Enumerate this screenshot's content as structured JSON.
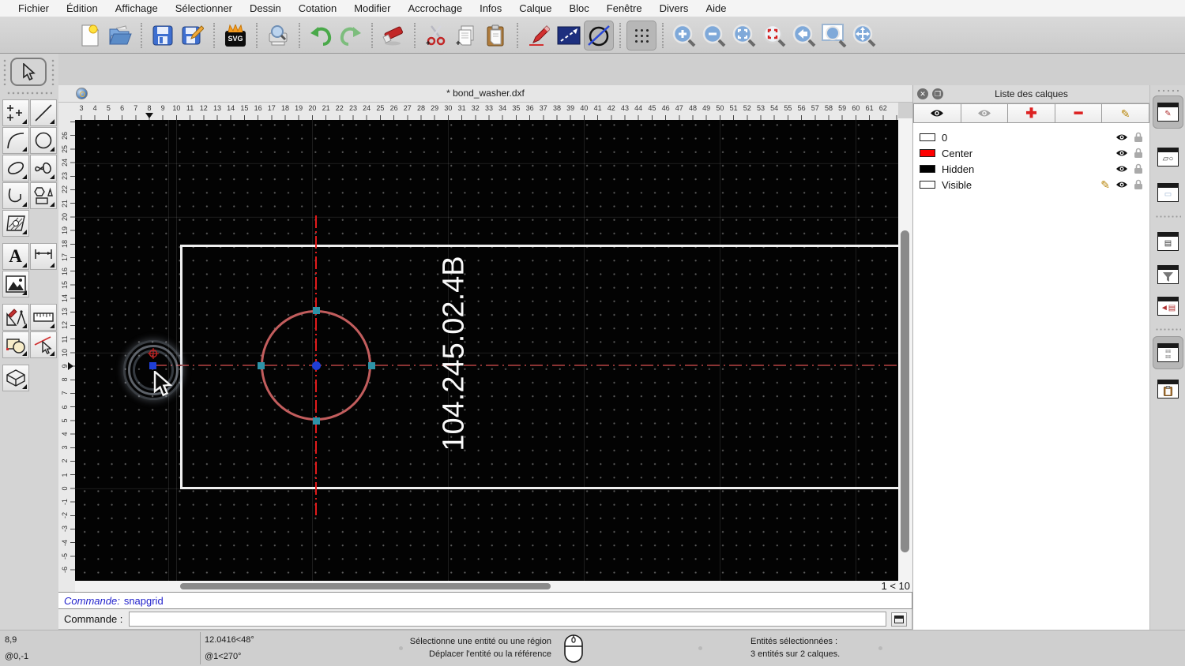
{
  "menubar": {
    "items": [
      "Fichier",
      "Édition",
      "Affichage",
      "Sélectionner",
      "Dessin",
      "Cotation",
      "Modifier",
      "Accrochage",
      "Infos",
      "Calque",
      "Bloc",
      "Fenêtre",
      "Divers",
      "Aide"
    ]
  },
  "toolbar": {
    "svg_label": "SVG"
  },
  "window": {
    "title": "* bond_washer.dxf"
  },
  "palette": {
    "text_tool_glyph": "A"
  },
  "rulers": {
    "top": {
      "values": [
        3,
        4,
        5,
        6,
        7,
        8,
        9,
        10,
        11,
        12,
        13,
        14,
        15,
        16,
        17,
        18,
        19,
        20,
        21,
        22,
        23,
        24,
        25,
        26,
        27,
        28,
        29,
        30,
        31,
        32,
        33,
        34,
        35,
        36,
        37,
        38,
        39,
        40,
        41,
        42,
        43,
        44,
        45,
        46,
        47,
        48,
        49,
        50,
        51,
        52,
        53,
        54,
        55,
        56,
        57,
        58,
        59,
        60,
        61,
        62
      ],
      "marker_value": 8
    },
    "left": {
      "values": [
        26,
        25,
        24,
        23,
        22,
        21,
        20,
        19,
        18,
        17,
        16,
        15,
        14,
        13,
        12,
        11,
        10,
        9,
        8,
        7,
        6,
        5,
        4,
        3,
        2,
        1,
        0,
        -1,
        -2,
        -3,
        -4,
        -5,
        -6
      ],
      "marker_value": 9
    }
  },
  "canvas": {
    "annotation_text": "104.245.02.4B",
    "scale_indicator": "1 < 10",
    "colors": {
      "background": "#030303",
      "entity_white": "#efefef",
      "selected_salmon": "#c25d5d",
      "centerline_red": "#e21b1b",
      "centerline_dark_red": "#8a3333",
      "grip_teal": "#2e93a8",
      "grip_blue": "#1f3ed6"
    }
  },
  "layer_panel": {
    "title": "Liste des calques",
    "layers": [
      {
        "name": "0",
        "swatch": "#ffffff",
        "current": false
      },
      {
        "name": "Center",
        "swatch": "#ff0000",
        "current": false
      },
      {
        "name": "Hidden",
        "swatch": "#000000",
        "current": false
      },
      {
        "name": "Visible",
        "swatch": "#ffffff",
        "current": true
      }
    ]
  },
  "command": {
    "history_label": "Commande:",
    "history_value": "snapgrid",
    "prompt_label": "Commande :",
    "input_value": ""
  },
  "statusbar": {
    "abs_coord": "8,9",
    "rel_coord": "@0,-1",
    "polar_abs": "12.0416<48°",
    "polar_rel": "@1<270°",
    "hint_line1": "Sélectionne une entité ou une région",
    "hint_line2": "Déplacer l'entité ou la référence",
    "selection_line1": "Entités sélectionnées :",
    "selection_line2": "3 entités sur 2 calques."
  }
}
